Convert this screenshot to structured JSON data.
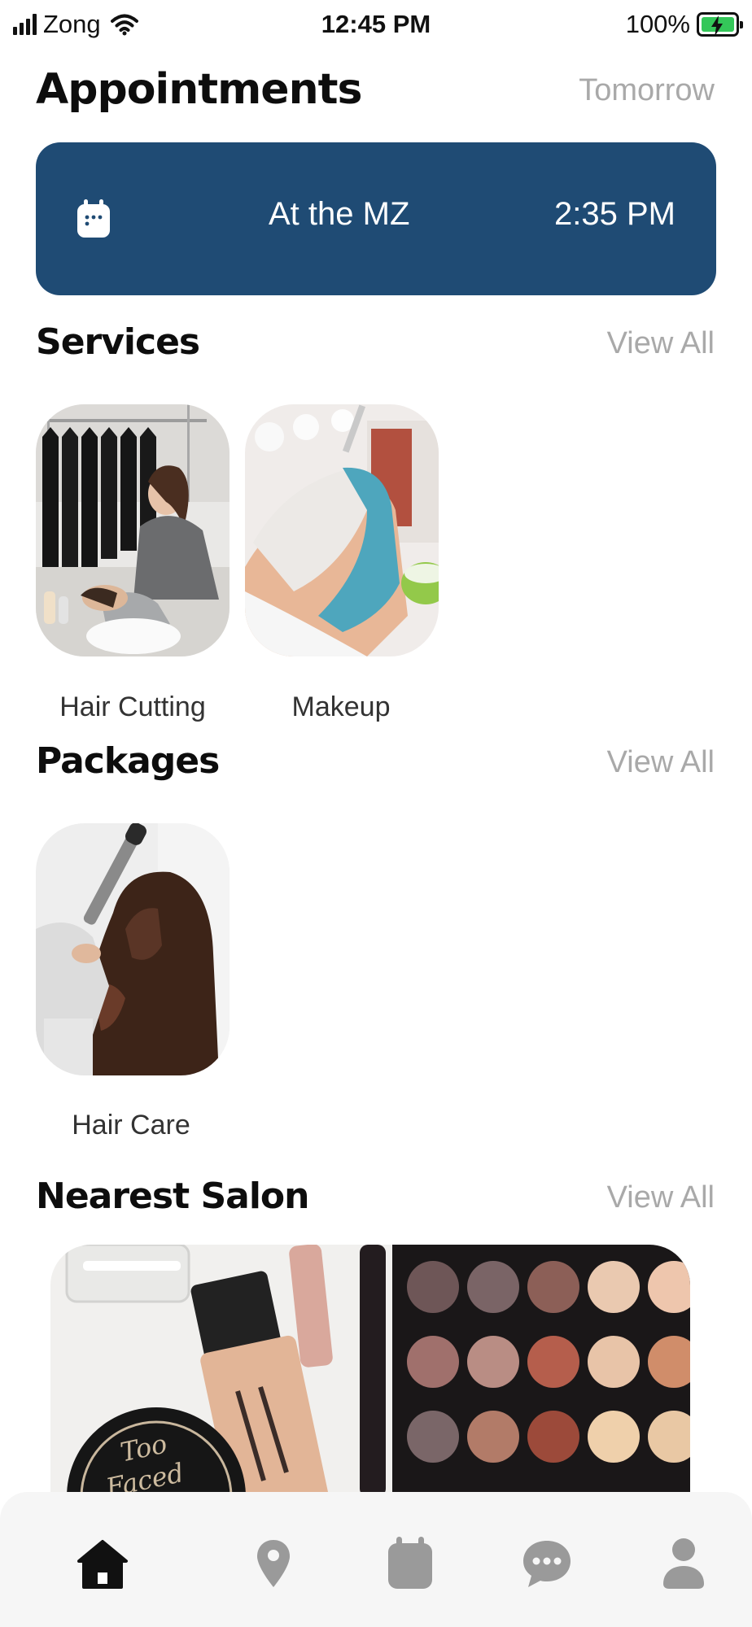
{
  "status_bar": {
    "carrier": "Zong",
    "time": "12:45 PM",
    "battery": "100%",
    "battery_level": 1.0
  },
  "appointments": {
    "title": "Appointments",
    "filter": "Tomorrow",
    "card": {
      "icon": "calendar-icon",
      "place": "At the MZ",
      "time": "2:35 PM",
      "background": "#1f4b74"
    }
  },
  "services": {
    "title": "Services",
    "view_all": "View All",
    "items": [
      {
        "label": "Hair Cutting",
        "image": "salon-hair-wash-photo"
      },
      {
        "label": "Makeup",
        "image": "facial-mask-photo"
      }
    ]
  },
  "packages": {
    "title": "Packages",
    "view_all": "View All",
    "items": [
      {
        "label": "Hair Care",
        "image": "hair-curling-photo"
      }
    ]
  },
  "nearest_salon": {
    "title": "Nearest Salon",
    "view_all": "View All",
    "image": "makeup-products-photo"
  },
  "bottom_nav": {
    "items": [
      {
        "icon": "home-icon",
        "active": true
      },
      {
        "icon": "location-pin-icon",
        "active": false
      },
      {
        "icon": "calendar-icon",
        "active": false
      },
      {
        "icon": "chat-bubble-icon",
        "active": false
      },
      {
        "icon": "profile-icon",
        "active": false
      }
    ]
  },
  "colors": {
    "accent": "#1f4b74",
    "muted_text": "#a9a9a9",
    "active_nav": "#111111",
    "inactive_nav": "#9a9a9a",
    "battery": "#34c759"
  }
}
